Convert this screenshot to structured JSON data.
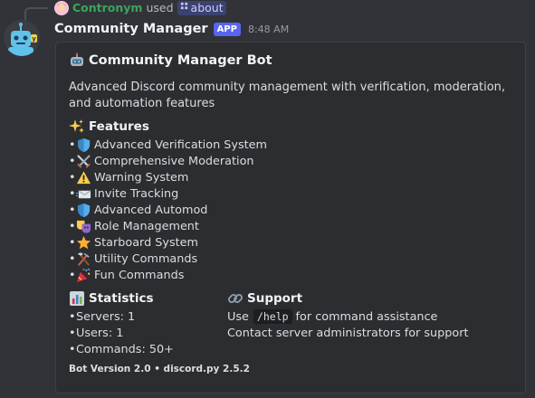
{
  "reply": {
    "username": "Contronym",
    "used_text": "used",
    "command": "about",
    "avatar_icon": "user-avatar"
  },
  "message": {
    "author": "Community Manager",
    "badge": "APP",
    "timestamp": "8:48 AM",
    "avatar_icon": "robot-avatar"
  },
  "embed": {
    "title": "Community Manager Bot",
    "title_icon": "robot-icon",
    "description": "Advanced Discord community management with verification, moderation, and automation features",
    "features": {
      "name": "Features",
      "icon": "sparkles-icon",
      "items": [
        {
          "icon": "shield-icon",
          "label": "Advanced Verification System"
        },
        {
          "icon": "crossed-swords-icon",
          "label": "Comprehensive Moderation"
        },
        {
          "icon": "warning-icon",
          "label": "Warning System"
        },
        {
          "icon": "incoming-envelope-icon",
          "label": "Invite Tracking"
        },
        {
          "icon": "shield-icon",
          "label": "Advanced Automod"
        },
        {
          "icon": "performing-arts-icon",
          "label": "Role Management"
        },
        {
          "icon": "star-icon",
          "label": "Starboard System"
        },
        {
          "icon": "hammer-pick-icon",
          "label": "Utility Commands"
        },
        {
          "icon": "party-popper-icon",
          "label": "Fun Commands"
        }
      ]
    },
    "statistics": {
      "name": "Statistics",
      "icon": "bar-chart-icon",
      "items": [
        "Servers: 1",
        "Users: 1",
        "Commands: 50+"
      ]
    },
    "support": {
      "name": "Support",
      "icon": "link-icon",
      "line1_prefix": "Use",
      "line1_code": "/help",
      "line1_suffix": "for command assistance",
      "line2": "Contact server administrators for support"
    },
    "footer": "Bot Version 2.0 • discord.py 2.5.2"
  },
  "colors": {
    "background": "#313338",
    "embed_background": "#2b2d31",
    "app_badge": "#5865f2",
    "reply_username": "#3ba55c"
  }
}
